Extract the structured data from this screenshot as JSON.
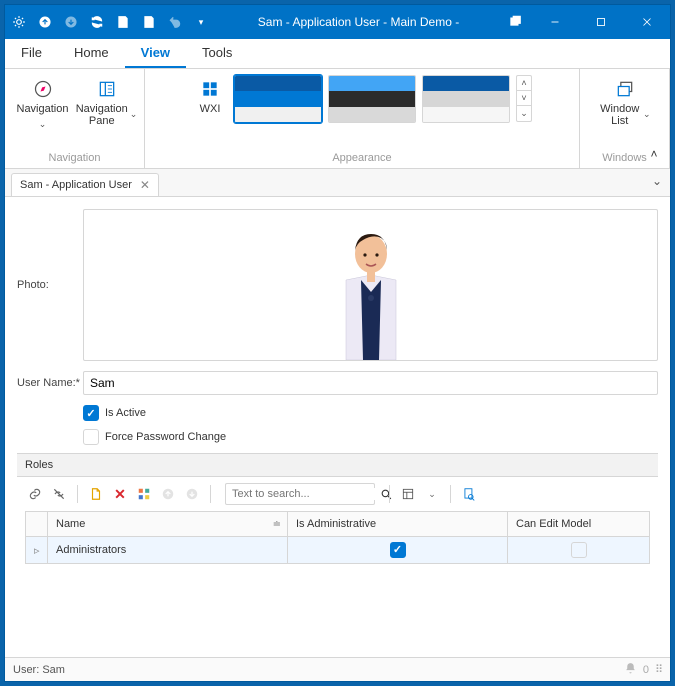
{
  "colors": {
    "accent": "#0078d4",
    "titlebar": "#0072c6"
  },
  "titlebar": {
    "title": "Sam - Application User - Main Demo -"
  },
  "menu": {
    "items": [
      "File",
      "Home",
      "View",
      "Tools"
    ],
    "active": "View"
  },
  "ribbon": {
    "navigation": {
      "group_label": "Navigation",
      "navigation_label": "Navigation",
      "pane_label": "Navigation Pane"
    },
    "wxi_label": "WXI",
    "appearance_label": "Appearance",
    "windows": {
      "group_label": "Windows",
      "list_label": "Window List"
    },
    "themes": [
      {
        "name": "blue-white",
        "bands": [
          "#0a5aa5",
          "#0078d4",
          "#f0f0f0"
        ],
        "selected": true
      },
      {
        "name": "blue-dark",
        "bands": [
          "#42a5f5",
          "#2b2b2b",
          "#d9d9d9"
        ],
        "selected": false
      },
      {
        "name": "blue-grey",
        "bands": [
          "#0a5aa5",
          "#d6d6d6",
          "#f6f6f6"
        ],
        "selected": false
      }
    ]
  },
  "tab": {
    "label": "Sam - Application User"
  },
  "form": {
    "photo_label": "Photo:",
    "username_label": "User Name:*",
    "username_value": "Sam",
    "is_active_label": "Is Active",
    "is_active": true,
    "force_pwd_label": "Force Password Change",
    "force_pwd": false
  },
  "roles": {
    "section_label": "Roles",
    "search_placeholder": "Text to search...",
    "columns": [
      "Name",
      "Is Administrative",
      "Can Edit Model"
    ],
    "rows": [
      {
        "name": "Administrators",
        "is_admin": true,
        "can_edit": false
      }
    ]
  },
  "status": {
    "user_prefix": "User:",
    "user": "Sam",
    "notifications": "0"
  }
}
